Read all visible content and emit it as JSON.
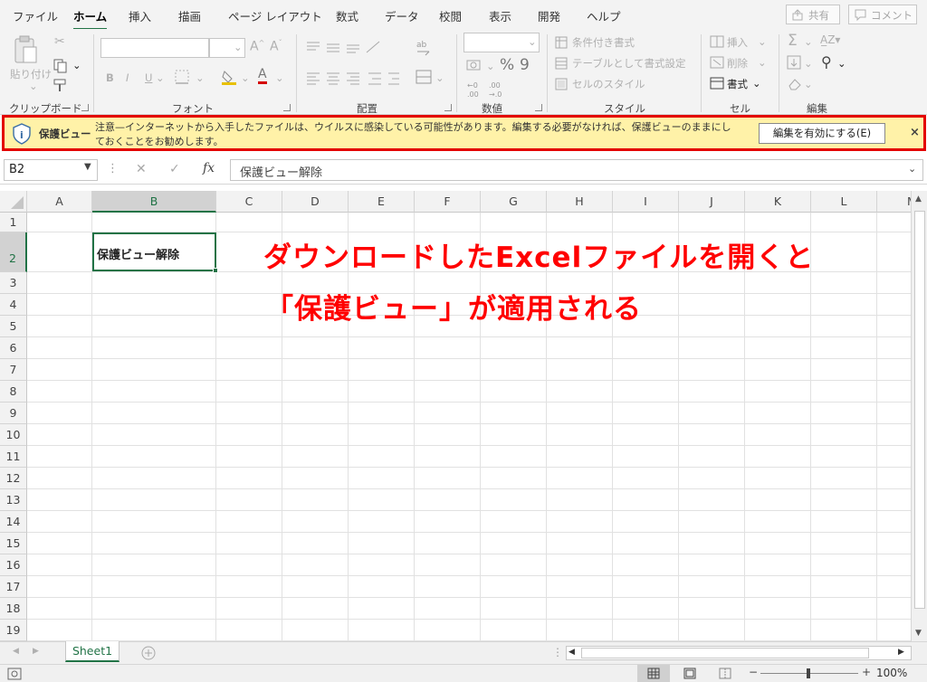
{
  "tabs": [
    "ファイル",
    "ホーム",
    "挿入",
    "描画",
    "ページ レイアウト",
    "数式",
    "データ",
    "校閲",
    "表示",
    "開発",
    "ヘルプ"
  ],
  "active_tab": "ホーム",
  "top_buttons": {
    "share": "共有",
    "comment": "コメント"
  },
  "ribbon": {
    "clipboard": {
      "label": "クリップボード",
      "paste": "貼り付け"
    },
    "font": {
      "label": "フォント",
      "bold": "B",
      "italic": "I",
      "underline": "U"
    },
    "alignment": {
      "label": "配置"
    },
    "number": {
      "label": "数値",
      "percent": "%",
      "comma": "9"
    },
    "styles": {
      "label": "スタイル",
      "conditional": "条件付き書式",
      "as_table": "テーブルとして書式設定",
      "cell_styles": "セルのスタイル"
    },
    "cells": {
      "label": "セル",
      "insert": "挿入",
      "delete": "削除",
      "format": "書式"
    },
    "editing": {
      "label": "編集"
    }
  },
  "protected_view": {
    "title": "保護ビュー",
    "message": "注意—インターネットから入手したファイルは、ウイルスに感染している可能性があります。編集する必要がなければ、保護ビューのままにしておくことをお勧めします。",
    "enable_button": "編集を有効にする(E)",
    "close": "×"
  },
  "formula_bar": {
    "name_box": "B2",
    "fx": "fx",
    "cancel": "✕",
    "enter": "✓",
    "value": "保護ビュー解除"
  },
  "columns": [
    "A",
    "B",
    "C",
    "D",
    "E",
    "F",
    "G",
    "H",
    "I",
    "J",
    "K",
    "L",
    "M"
  ],
  "rows": [
    "1",
    "2",
    "3",
    "4",
    "5",
    "6",
    "7",
    "8",
    "9",
    "10",
    "11",
    "12",
    "13",
    "14",
    "15",
    "16",
    "17",
    "18",
    "19"
  ],
  "cell_b2": "保護ビュー解除",
  "annotation": {
    "line1": "ダウンロードしたExcelファイルを開くと",
    "line2": "「保護ビュー」が適用される"
  },
  "sheet_tab": "Sheet1",
  "status": {
    "zoom": "100%"
  },
  "colors": {
    "accent": "#217346",
    "warning_bar": "#fff2a8",
    "warning_border": "#e30000",
    "annotation": "#ff0000"
  }
}
